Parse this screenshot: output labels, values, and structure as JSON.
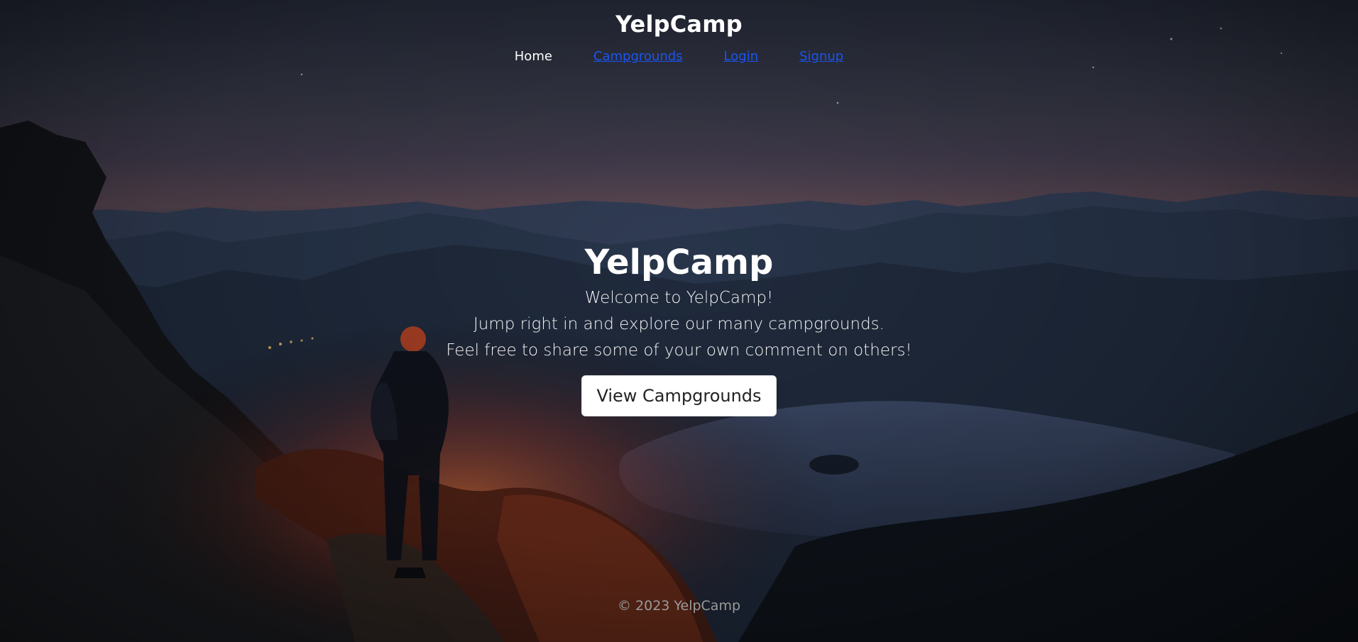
{
  "app": {
    "brand": "YelpCamp"
  },
  "nav": {
    "items": [
      {
        "label": "Home",
        "active": true
      },
      {
        "label": "Campgrounds",
        "active": false
      },
      {
        "label": "Login",
        "active": false
      },
      {
        "label": "Signup",
        "active": false
      }
    ]
  },
  "hero": {
    "title": "YelpCamp",
    "lines": [
      "Welcome to YelpCamp!",
      "Jump right in and explore our many campgrounds.",
      "Feel free to share some of your own comment on others!"
    ],
    "button_label": "View Campgrounds"
  },
  "footer": {
    "text": "© 2023 YelpCamp"
  },
  "colors": {
    "nav_link_inactive": "#1a55f0",
    "nav_link_active": "#ffffff",
    "text": "#ffffff",
    "footer_text": "#9a9a9a",
    "button_bg": "#ffffff",
    "button_text": "#222222"
  },
  "background": {
    "scene": "night-mountain-lake-hiker",
    "description_icon": "landscape-photo"
  }
}
